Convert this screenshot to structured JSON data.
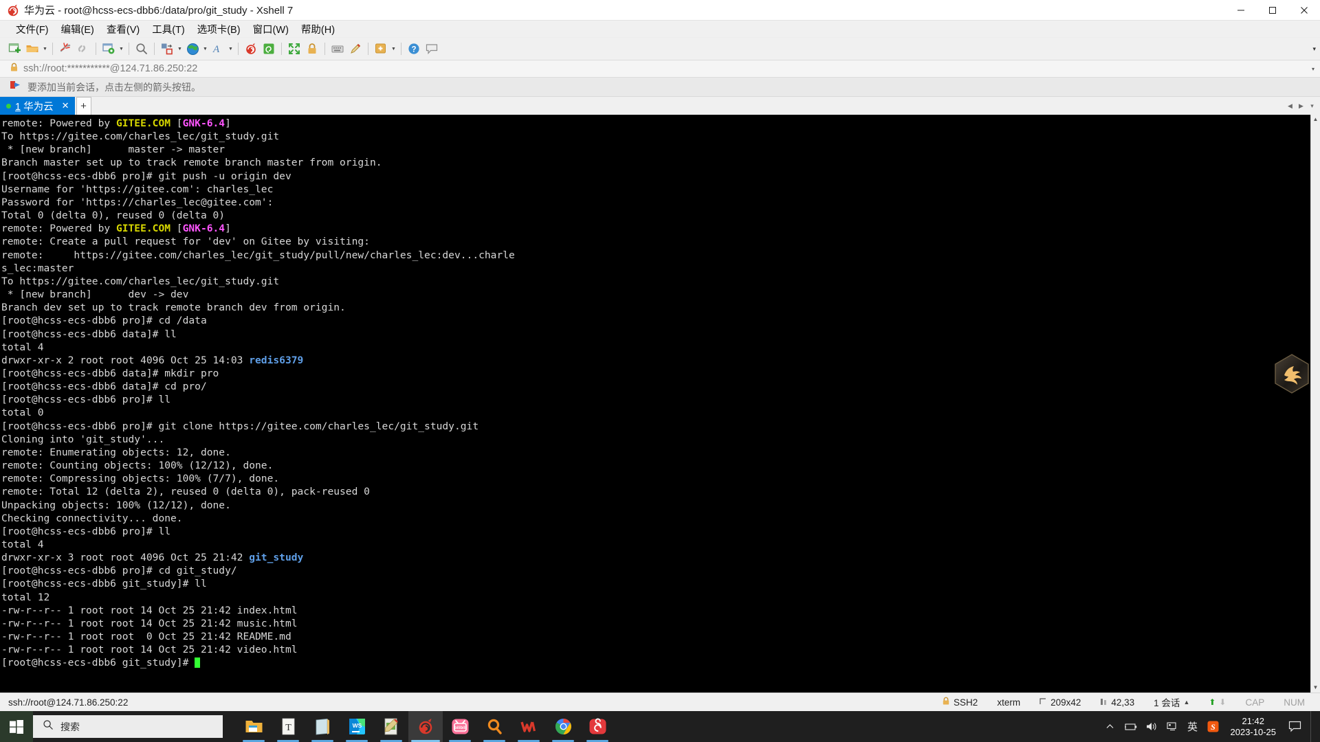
{
  "window": {
    "title": "华为云 - root@hcss-ecs-dbb6:/data/pro/git_study - Xshell 7",
    "minimize": "−",
    "maximize": "▢",
    "close": "✕"
  },
  "menu": {
    "items": [
      {
        "label": "文件(F)",
        "name": "menu-file"
      },
      {
        "label": "编辑(E)",
        "name": "menu-edit"
      },
      {
        "label": "查看(V)",
        "name": "menu-view"
      },
      {
        "label": "工具(T)",
        "name": "menu-tools"
      },
      {
        "label": "选项卡(B)",
        "name": "menu-tabs"
      },
      {
        "label": "窗口(W)",
        "name": "menu-window"
      },
      {
        "label": "帮助(H)",
        "name": "menu-help"
      }
    ]
  },
  "toolbar": {
    "overflow": "▾",
    "icons": [
      "new-session-icon",
      "open-folder-icon",
      "folder-dropdown-caret",
      "disconnect-icon",
      "reconnect-icon",
      "session-properties-icon",
      "properties-dropdown-caret",
      "find-icon",
      "transfer-file-icon",
      "transfer-dropdown-caret",
      "globe-icon",
      "globe-dropdown-caret",
      "font-icon",
      "font-dropdown-caret",
      "xshell-icon",
      "xftp-icon",
      "fullscreen-icon",
      "lock-icon",
      "keyboard-icon",
      "compose-pane-icon",
      "add-bookmark-icon"
    ]
  },
  "address": {
    "lock_icon": "lock-icon",
    "value": "ssh://root:***********@124.71.86.250:22",
    "caret": "▾"
  },
  "notice": {
    "icon": "arrow-flag-icon",
    "text": "要添加当前会话，点击左侧的箭头按钮。"
  },
  "tabs": {
    "active": {
      "index": "1",
      "label": "华为云",
      "close": "✕",
      "status_dot_color": "#37d13c"
    },
    "add_label": "+",
    "scroll_left": "◀",
    "scroll_right": "▶",
    "list_caret": "▾"
  },
  "terminal": {
    "bg": "#000000",
    "fg": "#d8d8d8",
    "cursor_color": "#33ff33",
    "colors": {
      "yellow": "#d7d700",
      "magenta": "#ff55ff",
      "blue": "#5f9fe8"
    },
    "lines": [
      [
        {
          "t": "remote: Powered by "
        },
        {
          "t": "GITEE.COM",
          "c": "yellow"
        },
        {
          "t": " ["
        },
        {
          "t": "GNK-6.4",
          "c": "magenta"
        },
        {
          "t": "]"
        }
      ],
      [
        {
          "t": "To https://gitee.com/charles_lec/git_study.git"
        }
      ],
      [
        {
          "t": " * [new branch]      master -> master"
        }
      ],
      [
        {
          "t": "Branch master set up to track remote branch master from origin."
        }
      ],
      [
        {
          "t": "[root@hcss-ecs-dbb6 pro]# git push -u origin dev"
        }
      ],
      [
        {
          "t": "Username for 'https://gitee.com': charles_lec"
        }
      ],
      [
        {
          "t": "Password for 'https://charles_lec@gitee.com':"
        }
      ],
      [
        {
          "t": "Total 0 (delta 0), reused 0 (delta 0)"
        }
      ],
      [
        {
          "t": "remote: Powered by "
        },
        {
          "t": "GITEE.COM",
          "c": "yellow"
        },
        {
          "t": " ["
        },
        {
          "t": "GNK-6.4",
          "c": "magenta"
        },
        {
          "t": "]"
        }
      ],
      [
        {
          "t": "remote: Create a pull request for 'dev' on Gitee by visiting:"
        }
      ],
      [
        {
          "t": "remote:     https://gitee.com/charles_lec/git_study/pull/new/charles_lec:dev...charle"
        }
      ],
      [
        {
          "t": "s_lec:master"
        }
      ],
      [
        {
          "t": "To https://gitee.com/charles_lec/git_study.git"
        }
      ],
      [
        {
          "t": " * [new branch]      dev -> dev"
        }
      ],
      [
        {
          "t": "Branch dev set up to track remote branch dev from origin."
        }
      ],
      [
        {
          "t": "[root@hcss-ecs-dbb6 pro]# cd /data"
        }
      ],
      [
        {
          "t": "[root@hcss-ecs-dbb6 data]# ll"
        }
      ],
      [
        {
          "t": "total 4"
        }
      ],
      [
        {
          "t": "drwxr-xr-x 2 root root 4096 Oct 25 14:03 "
        },
        {
          "t": "redis6379",
          "c": "blue"
        }
      ],
      [
        {
          "t": "[root@hcss-ecs-dbb6 data]# mkdir pro"
        }
      ],
      [
        {
          "t": "[root@hcss-ecs-dbb6 data]# cd pro/"
        }
      ],
      [
        {
          "t": "[root@hcss-ecs-dbb6 pro]# ll"
        }
      ],
      [
        {
          "t": "total 0"
        }
      ],
      [
        {
          "t": "[root@hcss-ecs-dbb6 pro]# git clone https://gitee.com/charles_lec/git_study.git"
        }
      ],
      [
        {
          "t": "Cloning into 'git_study'..."
        }
      ],
      [
        {
          "t": "remote: Enumerating objects: 12, done."
        }
      ],
      [
        {
          "t": "remote: Counting objects: 100% (12/12), done."
        }
      ],
      [
        {
          "t": "remote: Compressing objects: 100% (7/7), done."
        }
      ],
      [
        {
          "t": "remote: Total 12 (delta 2), reused 0 (delta 0), pack-reused 0"
        }
      ],
      [
        {
          "t": "Unpacking objects: 100% (12/12), done."
        }
      ],
      [
        {
          "t": "Checking connectivity... done."
        }
      ],
      [
        {
          "t": "[root@hcss-ecs-dbb6 pro]# ll"
        }
      ],
      [
        {
          "t": "total 4"
        }
      ],
      [
        {
          "t": "drwxr-xr-x 3 root root 4096 Oct 25 21:42 "
        },
        {
          "t": "git_study",
          "c": "blue"
        }
      ],
      [
        {
          "t": "[root@hcss-ecs-dbb6 pro]# cd git_study/"
        }
      ],
      [
        {
          "t": "[root@hcss-ecs-dbb6 git_study]# ll"
        }
      ],
      [
        {
          "t": "total 12"
        }
      ],
      [
        {
          "t": "-rw-r--r-- 1 root root 14 Oct 25 21:42 index.html"
        }
      ],
      [
        {
          "t": "-rw-r--r-- 1 root root 14 Oct 25 21:42 music.html"
        }
      ],
      [
        {
          "t": "-rw-r--r-- 1 root root  0 Oct 25 21:42 README.md"
        }
      ],
      [
        {
          "t": "-rw-r--r-- 1 root root 14 Oct 25 21:42 video.html"
        }
      ],
      [
        {
          "t": "[root@hcss-ecs-dbb6 git_study]# ",
          "cursor": true
        }
      ]
    ]
  },
  "statusbar": {
    "connection": "ssh://root@124.71.86.250:22",
    "protocol": "SSH2",
    "terminal_type": "xterm",
    "size": "209x42",
    "cursor_pos": "42,33",
    "sessions": "1 会话",
    "sessions_caret": "▲",
    "upload_arrow": "⬆",
    "download_arrow": "⬇",
    "caps": "CAP",
    "num": "NUM"
  },
  "taskbar": {
    "start_icon": "windows-start-icon",
    "search_placeholder": "搜索",
    "search_icon": "search-icon",
    "apps": [
      {
        "name": "taskbar-file-explorer",
        "label": "文件资源管理器"
      },
      {
        "name": "taskbar-typora",
        "label": "Typora"
      },
      {
        "name": "taskbar-notepad",
        "label": "记事本"
      },
      {
        "name": "taskbar-webstorm",
        "label": "WebStorm"
      },
      {
        "name": "taskbar-editor",
        "label": "编辑器"
      },
      {
        "name": "taskbar-xshell",
        "label": "Xshell 7"
      },
      {
        "name": "taskbar-bilibili",
        "label": "bilibili"
      },
      {
        "name": "taskbar-everything",
        "label": "Everything"
      },
      {
        "name": "taskbar-wps",
        "label": "WPS"
      },
      {
        "name": "taskbar-chrome",
        "label": "Google Chrome"
      },
      {
        "name": "taskbar-netease-music",
        "label": "网易云音乐"
      }
    ],
    "tray": {
      "chevron": "⌃",
      "icons": [
        "battery-icon",
        "volume-icon",
        "network-icon"
      ],
      "ime": "英",
      "sogou": "S"
    },
    "clock": {
      "time": "21:42",
      "date": "2023-10-25"
    },
    "notifications_icon": "notification-icon"
  }
}
